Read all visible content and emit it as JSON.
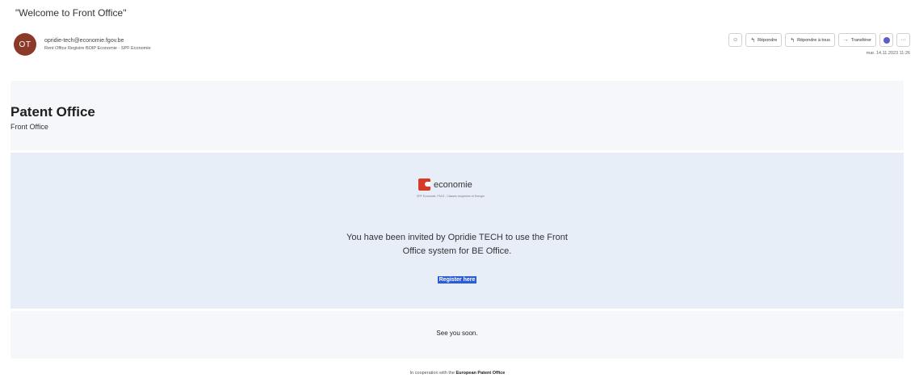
{
  "email": {
    "subject": "\"Welcome to Front Office\"",
    "sender_initials": "OT",
    "sender_email": "opridie-tech@economie.fgov.be",
    "recipients": "Rent Office Registre BOIP Economie · SPF Economie",
    "date": "mar. 14.11.2023 11:26"
  },
  "actions": {
    "emoji_icon": "emoji-icon",
    "reply": "Répondre",
    "reply_all": "Répondre à tous",
    "forward": "Transférer",
    "teams_icon": "teams-icon",
    "more": "···"
  },
  "header": {
    "title": "Patent Office",
    "subtitle": "Front Office"
  },
  "main": {
    "logo_text": "economie",
    "logo_tagline": "SPF Economie, P.M.E., Classes moyennes et Energie",
    "invite_line1": "You have been invited by Opridie TECH to use the Front",
    "invite_line2": "Office system for BE Office.",
    "register_link": "Register here"
  },
  "footer": {
    "closing": "See you soon."
  },
  "cooperation": {
    "prefix": "In cooperation with the",
    "partner": "European Patent Office"
  },
  "colors": {
    "avatar": "#8b3a2a",
    "logo_red": "#d93a26",
    "link_highlight": "#2b5bd7",
    "main_bg": "#e8eef7",
    "panel_bg": "#f6f7fb"
  }
}
